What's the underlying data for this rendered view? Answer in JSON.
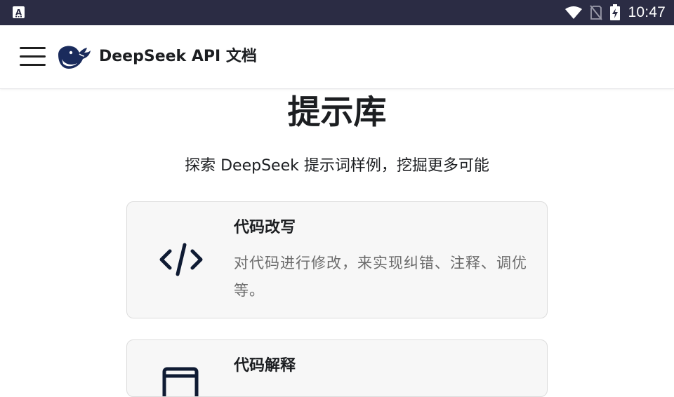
{
  "status_bar": {
    "time": "10:47",
    "left_icon": "accessibility-a-icon",
    "right_icons": [
      "wifi-icon",
      "no-sim-icon",
      "battery-charging-icon"
    ],
    "background": "#2b2c44"
  },
  "header": {
    "menu_icon": "hamburger-menu-icon",
    "logo": "deepseek-whale-logo",
    "title": "DeepSeek API 文档",
    "logo_color": "#1a2b5c"
  },
  "main": {
    "title": "提示库",
    "subtitle": "探索 DeepSeek 提示词样例，挖掘更多可能",
    "cards": [
      {
        "icon": "code-icon",
        "title": "代码改写",
        "description": "对代码进行修改，来实现纠错、注释、调优等。"
      },
      {
        "icon": "terminal-window-icon",
        "title": "代码解释",
        "description": ""
      }
    ]
  }
}
